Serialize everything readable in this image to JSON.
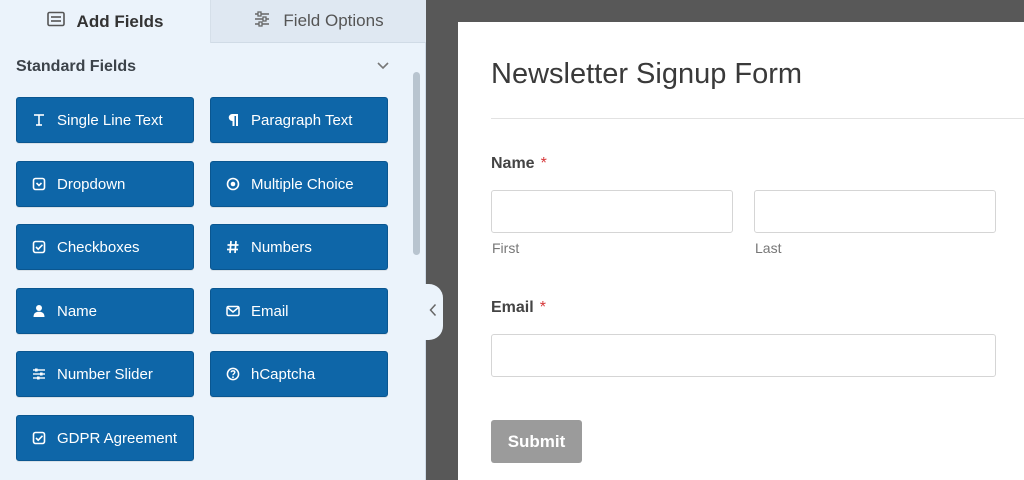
{
  "tabs": {
    "add_fields": "Add Fields",
    "field_options": "Field Options"
  },
  "section": {
    "title": "Standard Fields"
  },
  "fields": [
    {
      "label": "Single Line Text",
      "icon": "text-cursor-icon"
    },
    {
      "label": "Paragraph Text",
      "icon": "pilcrow-icon"
    },
    {
      "label": "Dropdown",
      "icon": "dropdown-icon"
    },
    {
      "label": "Multiple Choice",
      "icon": "radio-icon"
    },
    {
      "label": "Checkboxes",
      "icon": "checkbox-icon"
    },
    {
      "label": "Numbers",
      "icon": "hash-icon"
    },
    {
      "label": "Name",
      "icon": "user-icon"
    },
    {
      "label": "Email",
      "icon": "envelope-icon"
    },
    {
      "label": "Number Slider",
      "icon": "sliders-icon"
    },
    {
      "label": "hCaptcha",
      "icon": "question-circle-icon"
    },
    {
      "label": "GDPR Agreement",
      "icon": "checkbox-icon"
    }
  ],
  "form": {
    "title": "Newsletter Signup Form",
    "name_label": "Name",
    "required_mark": "*",
    "first_sublabel": "First",
    "last_sublabel": "Last",
    "email_label": "Email",
    "submit_label": "Submit"
  },
  "colors": {
    "field_button": "#0e66a8",
    "panel_bg": "#ebf3fb",
    "canvas_bg": "#585858",
    "required": "#d63638",
    "submit_bg": "#9b9b9b"
  }
}
